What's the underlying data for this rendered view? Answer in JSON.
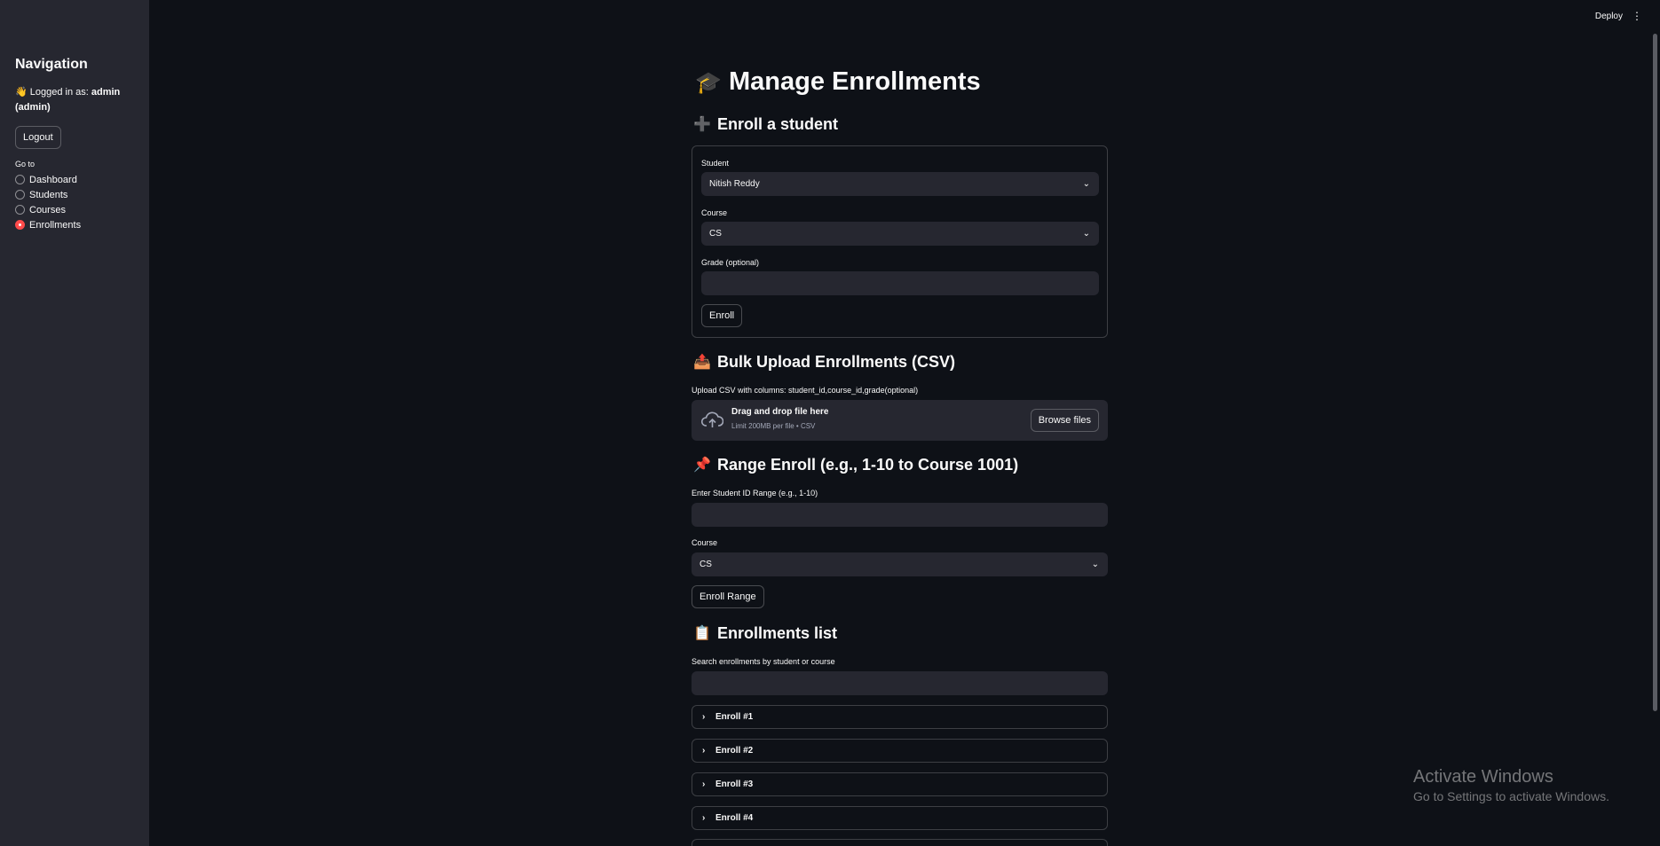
{
  "header": {
    "deploy_label": "Deploy",
    "menu_icon": "⋮"
  },
  "sidebar": {
    "title": "Navigation",
    "logged_prefix": "👋 Logged in as: ",
    "username": "admin",
    "role": "(admin)",
    "logout_label": "Logout",
    "goto_label": "Go to",
    "items": [
      {
        "label": "Dashboard",
        "selected": false
      },
      {
        "label": "Students",
        "selected": false
      },
      {
        "label": "Courses",
        "selected": false
      },
      {
        "label": "Enrollments",
        "selected": true
      }
    ]
  },
  "page": {
    "title_icon": "🎓",
    "title": "Manage Enrollments"
  },
  "enroll_form": {
    "heading_icon": "➕",
    "heading": "Enroll a student",
    "student_label": "Student",
    "student_value": "Nitish Reddy",
    "course_label": "Course",
    "course_value": "CS",
    "grade_label": "Grade (optional)",
    "grade_value": "",
    "enroll_label": "Enroll"
  },
  "bulk_upload": {
    "heading_icon": "📤",
    "heading": "Bulk Upload Enrollments (CSV)",
    "caption": "Upload CSV with columns: student_id,course_id,grade(optional)",
    "drop_text": "Drag and drop file here",
    "limit_text": "Limit 200MB per file • CSV",
    "browse_label": "Browse files"
  },
  "range_enroll": {
    "heading_icon": "📌",
    "heading": "Range Enroll (e.g., 1-10 to Course 1001)",
    "range_label": "Enter Student ID Range (e.g., 1-10)",
    "range_value": "",
    "course_label": "Course",
    "course_value": "CS",
    "button_label": "Enroll Range"
  },
  "enrollments_list": {
    "heading_icon": "📋",
    "heading": "Enrollments list",
    "search_label": "Search enrollments by student or course",
    "search_value": "",
    "items": [
      "Enroll #1",
      "Enroll #2",
      "Enroll #3",
      "Enroll #4"
    ]
  },
  "watermark": {
    "line1": "Activate Windows",
    "line2": "Go to Settings to activate Windows."
  }
}
